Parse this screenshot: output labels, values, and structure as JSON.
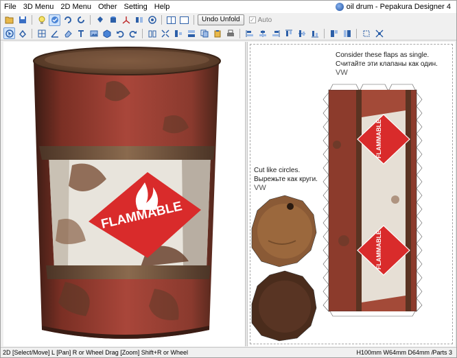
{
  "menu": [
    "File",
    "3D Menu",
    "2D Menu",
    "Other",
    "Setting",
    "Help"
  ],
  "window_title": "oil drum - Pepakura Designer 4",
  "toolbar1": {
    "undo_unfold_label": "Undo Unfold",
    "auto_label": "Auto",
    "auto_checked": true,
    "auto_check_glyph": "✓"
  },
  "icons_row1": [
    "folder-open-icon",
    "save-icon",
    "light-bulb-icon",
    "light-bulb-active-icon",
    "rotate-icon",
    "rotate-alt-icon",
    "paint-bucket-icon",
    "cylinder-icon",
    "axis-icon",
    "flip-icon",
    "texture-icon",
    "single-pane-icon",
    "split-pane-icon"
  ],
  "icons_row2": [
    "select-icon",
    "rotate-tool-icon",
    "grid-icon",
    "angle-icon",
    "eraser-icon",
    "text-icon",
    "image-icon",
    "box-icon",
    "undo-icon",
    "redo-icon",
    "book-icon",
    "join-icon",
    "align-icon",
    "distribute-icon",
    "copy-icon",
    "paste-icon",
    "print-icon",
    "align-left-icon",
    "align-center-icon",
    "align-right-icon",
    "align-top-icon",
    "align-middle-icon",
    "align-bottom-icon",
    "arrange-icon",
    "arrange-alt-icon",
    "fit-icon",
    "fit-all-icon"
  ],
  "model3d": {
    "label_text": "FLAMMABLE"
  },
  "pattern2d": {
    "note1_line1": "Consider these flaps as single.",
    "note1_line2": "Считайте эти клапаны как один.",
    "note1_sig": "VW",
    "note2_line1": "Cut like circles.",
    "note2_line2": "Вырежьте как круги.",
    "note2_sig": "VW",
    "strip_label": "FLAMMABLE"
  },
  "status": {
    "left": "2D [Select/Move] L [Pan] R or Wheel Drag [Zoom] Shift+R or Wheel",
    "dims": "H100mm W64mm D64mm /",
    "parts": "Parts 3"
  },
  "colors": {
    "drum_red": "#9a3b2e",
    "rust_brown": "#6b4a32",
    "accent_blue": "#2c5fa8"
  }
}
